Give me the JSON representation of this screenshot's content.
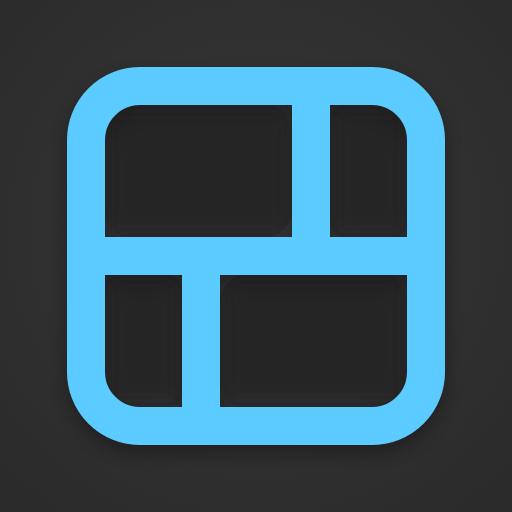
{
  "icon": {
    "name": "collage-layout-icon",
    "colors": {
      "background": "#2f2f2f",
      "stroke": "#5ccbff",
      "panel": "#2d2d2d",
      "panel_shadow": "#1d1d1d"
    }
  }
}
